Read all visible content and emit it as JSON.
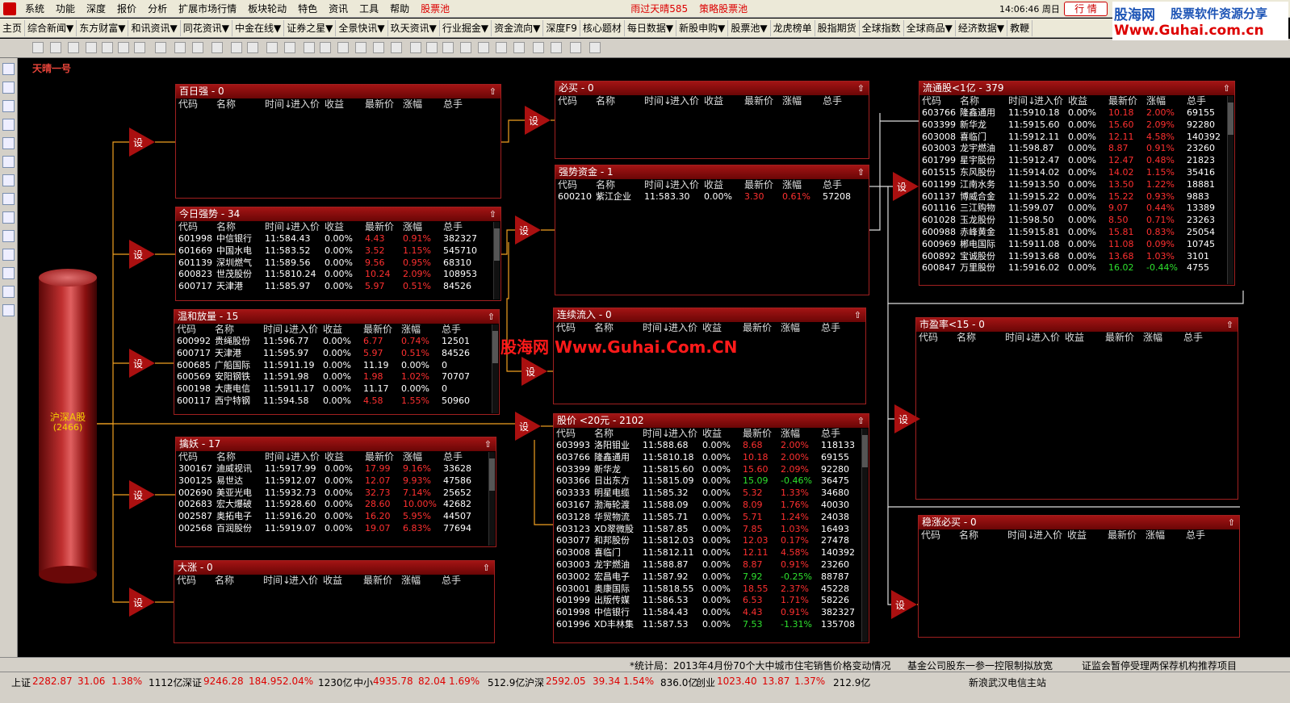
{
  "menu": {
    "items": [
      "系统",
      "功能",
      "深度",
      "报价",
      "分析",
      "扩展市场行情",
      "板块轮动",
      "特色",
      "资讯",
      "工具",
      "帮助"
    ],
    "pool": "股票池",
    "center_links": [
      "雨过天晴585",
      "策略股票池"
    ],
    "clock": "14:06:46 周日",
    "quote_button": "行 情"
  },
  "brand": {
    "cn": "股海网",
    "tagline": "股票软件资源分享",
    "url": "Www.Guhai.com.cn"
  },
  "toolbar": [
    "主页",
    "综合新闻▼",
    "东方财富▼",
    "和讯资讯▼",
    "同花资讯▼",
    "中金在线▼",
    "证券之星▼",
    "全景快讯▼",
    "玖天资讯▼",
    "行业掘金▼",
    "资金流向▼",
    "深度F9",
    "核心题材",
    "每日数据▼",
    "新股申购▼",
    "股票池▼",
    "龙虎榜单",
    "股指期货",
    "全球指数",
    "全球商品▼",
    "经济数据▼",
    "教鞭"
  ],
  "window_title": "天晴一号",
  "source": {
    "name": "沪深A股",
    "count": "(2466)"
  },
  "set_label": "设",
  "watermark": "股海网 Www.Guhai.Com.CN",
  "columns": [
    "代码",
    "名称",
    "时间↓",
    "进入价",
    "收益",
    "最新价",
    "涨幅",
    "总手"
  ],
  "panels": [
    {
      "id": "p1",
      "title": "百日强 - 0",
      "rows": []
    },
    {
      "id": "p2",
      "title": "今日强势 - 34",
      "rows": [
        [
          "601998",
          "中信银行",
          "11:58",
          "4.43",
          "0.00%",
          "4.43",
          "0.91%",
          "382327",
          "r"
        ],
        [
          "601669",
          "中国水电",
          "11:58",
          "3.52",
          "0.00%",
          "3.52",
          "1.15%",
          "545710",
          "r"
        ],
        [
          "601139",
          "深圳燃气",
          "11:58",
          "9.56",
          "0.00%",
          "9.56",
          "0.95%",
          "68310",
          "r"
        ],
        [
          "600823",
          "世茂股份",
          "11:58",
          "10.24",
          "0.00%",
          "10.24",
          "2.09%",
          "108953",
          "r"
        ],
        [
          "600717",
          "天津港",
          "11:58",
          "5.97",
          "0.00%",
          "5.97",
          "0.51%",
          "84526",
          "r"
        ]
      ]
    },
    {
      "id": "p3",
      "title": "温和放量 - 15",
      "rows": [
        [
          "600992",
          "贵绳股份",
          "11:59",
          "6.77",
          "0.00%",
          "6.77",
          "0.74%",
          "12501",
          "r"
        ],
        [
          "600717",
          "天津港",
          "11:59",
          "5.97",
          "0.00%",
          "5.97",
          "0.51%",
          "84526",
          "r"
        ],
        [
          "600685",
          "广船国际",
          "11:59",
          "11.19",
          "0.00%",
          "11.19",
          "0.00%",
          "0",
          "w"
        ],
        [
          "600569",
          "安阳钢铁",
          "11:59",
          "1.98",
          "0.00%",
          "1.98",
          "1.02%",
          "70707",
          "r"
        ],
        [
          "600198",
          "大唐电信",
          "11:59",
          "11.17",
          "0.00%",
          "11.17",
          "0.00%",
          "0",
          "w"
        ],
        [
          "600117",
          "西宁特钢",
          "11:59",
          "4.58",
          "0.00%",
          "4.58",
          "1.55%",
          "50960",
          "r"
        ]
      ]
    },
    {
      "id": "p4",
      "title": "擒妖 - 17",
      "rows": [
        [
          "300167",
          "迪威视讯",
          "11:59",
          "17.99",
          "0.00%",
          "17.99",
          "9.16%",
          "33628",
          "r"
        ],
        [
          "300125",
          "易世达",
          "11:59",
          "12.07",
          "0.00%",
          "12.07",
          "9.93%",
          "47586",
          "r"
        ],
        [
          "002690",
          "美亚光电",
          "11:59",
          "32.73",
          "0.00%",
          "32.73",
          "7.14%",
          "25652",
          "r"
        ],
        [
          "002683",
          "宏大爆破",
          "11:59",
          "28.60",
          "0.00%",
          "28.60",
          "10.00%",
          "42682",
          "r"
        ],
        [
          "002587",
          "奥拓电子",
          "11:59",
          "16.20",
          "0.00%",
          "16.20",
          "5.95%",
          "44507",
          "r"
        ],
        [
          "002568",
          "百润股份",
          "11:59",
          "19.07",
          "0.00%",
          "19.07",
          "6.83%",
          "77694",
          "r"
        ]
      ]
    },
    {
      "id": "p5",
      "title": "大涨 - 0",
      "rows": []
    },
    {
      "id": "p6",
      "title": "必买 - 0",
      "rows": []
    },
    {
      "id": "p7",
      "title": "强势资金 - 1",
      "rows": [
        [
          "600210",
          "紫江企业",
          "11:58",
          "3.30",
          "0.00%",
          "3.30",
          "0.61%",
          "57208",
          "r"
        ]
      ]
    },
    {
      "id": "p8",
      "title": "连续流入 - 0",
      "rows": []
    },
    {
      "id": "p9",
      "title": "股价 <20元 - 2102",
      "rows": [
        [
          "603993",
          "洛阳钼业",
          "11:58",
          "8.68",
          "0.00%",
          "8.68",
          "2.00%",
          "118133",
          "r"
        ],
        [
          "603766",
          "隆鑫通用",
          "11:58",
          "10.18",
          "0.00%",
          "10.18",
          "2.00%",
          "69155",
          "r"
        ],
        [
          "603399",
          "新华龙",
          "11:58",
          "15.60",
          "0.00%",
          "15.60",
          "2.09%",
          "92280",
          "r"
        ],
        [
          "603366",
          "日出东方",
          "11:58",
          "15.09",
          "0.00%",
          "15.09",
          "-0.46%",
          "36475",
          "g"
        ],
        [
          "603333",
          "明星电缆",
          "11:58",
          "5.32",
          "0.00%",
          "5.32",
          "1.33%",
          "34680",
          "r"
        ],
        [
          "603167",
          "渤海轮渡",
          "11:58",
          "8.09",
          "0.00%",
          "8.09",
          "1.76%",
          "40030",
          "r"
        ],
        [
          "603128",
          "华贸物流",
          "11:58",
          "5.71",
          "0.00%",
          "5.71",
          "1.24%",
          "24038",
          "r"
        ],
        [
          "603123",
          "XD翠微股",
          "11:58",
          "7.85",
          "0.00%",
          "7.85",
          "1.03%",
          "16493",
          "r"
        ],
        [
          "603077",
          "和邦股份",
          "11:58",
          "12.03",
          "0.00%",
          "12.03",
          "0.17%",
          "27478",
          "r"
        ],
        [
          "603008",
          "喜临门",
          "11:58",
          "12.11",
          "0.00%",
          "12.11",
          "4.58%",
          "140392",
          "r"
        ],
        [
          "603003",
          "龙宇燃油",
          "11:58",
          "8.87",
          "0.00%",
          "8.87",
          "0.91%",
          "23260",
          "r"
        ],
        [
          "603002",
          "宏昌电子",
          "11:58",
          "7.92",
          "0.00%",
          "7.92",
          "-0.25%",
          "88787",
          "g"
        ],
        [
          "603001",
          "奥康国际",
          "11:58",
          "18.55",
          "0.00%",
          "18.55",
          "2.37%",
          "45228",
          "r"
        ],
        [
          "601999",
          "出版传媒",
          "11:58",
          "6.53",
          "0.00%",
          "6.53",
          "1.71%",
          "58226",
          "r"
        ],
        [
          "601998",
          "中信银行",
          "11:58",
          "4.43",
          "0.00%",
          "4.43",
          "0.91%",
          "382327",
          "r"
        ],
        [
          "601996",
          "XD丰林集",
          "11:58",
          "7.53",
          "0.00%",
          "7.53",
          "-1.31%",
          "135708",
          "g"
        ]
      ]
    },
    {
      "id": "p10",
      "title": "流通股<1亿 - 379",
      "rows": [
        [
          "603766",
          "隆鑫通用",
          "11:59",
          "10.18",
          "0.00%",
          "10.18",
          "2.00%",
          "69155",
          "r"
        ],
        [
          "603399",
          "新华龙",
          "11:59",
          "15.60",
          "0.00%",
          "15.60",
          "2.09%",
          "92280",
          "r"
        ],
        [
          "603008",
          "喜临门",
          "11:59",
          "12.11",
          "0.00%",
          "12.11",
          "4.58%",
          "140392",
          "r"
        ],
        [
          "603003",
          "龙宇燃油",
          "11:59",
          "8.87",
          "0.00%",
          "8.87",
          "0.91%",
          "23260",
          "r"
        ],
        [
          "601799",
          "星宇股份",
          "11:59",
          "12.47",
          "0.00%",
          "12.47",
          "0.48%",
          "21823",
          "r"
        ],
        [
          "601515",
          "东风股份",
          "11:59",
          "14.02",
          "0.00%",
          "14.02",
          "1.15%",
          "35416",
          "r"
        ],
        [
          "601199",
          "江南水务",
          "11:59",
          "13.50",
          "0.00%",
          "13.50",
          "1.22%",
          "18881",
          "r"
        ],
        [
          "601137",
          "博威合金",
          "11:59",
          "15.22",
          "0.00%",
          "15.22",
          "0.93%",
          "9883",
          "r"
        ],
        [
          "601116",
          "三江购物",
          "11:59",
          "9.07",
          "0.00%",
          "9.07",
          "0.44%",
          "13389",
          "r"
        ],
        [
          "601028",
          "玉龙股份",
          "11:59",
          "8.50",
          "0.00%",
          "8.50",
          "0.71%",
          "23263",
          "r"
        ],
        [
          "600988",
          "赤峰黄金",
          "11:59",
          "15.81",
          "0.00%",
          "15.81",
          "0.83%",
          "25054",
          "r"
        ],
        [
          "600969",
          "郴电国际",
          "11:59",
          "11.08",
          "0.00%",
          "11.08",
          "0.09%",
          "10745",
          "r"
        ],
        [
          "600892",
          "宝诚股份",
          "11:59",
          "13.68",
          "0.00%",
          "13.68",
          "1.03%",
          "3101",
          "r"
        ],
        [
          "600847",
          "万里股份",
          "11:59",
          "16.02",
          "0.00%",
          "16.02",
          "-0.44%",
          "4755",
          "g"
        ]
      ]
    },
    {
      "id": "p11",
      "title": "市盈率<15 - 0",
      "rows": []
    },
    {
      "id": "p12",
      "title": "稳涨必买 - 0",
      "rows": []
    }
  ],
  "ticker": [
    "*统计局：2013年4月份70个大中城市住宅销售价格变动情况",
    "基金公司股东一参一控限制拟放宽",
    "证监会暂停受理两保荐机构推荐项目"
  ],
  "status": {
    "sh": {
      "label": "上证",
      "value": "2282.87",
      "chg": "31.06",
      "pct": "1.38%",
      "amt": "1112亿"
    },
    "sz": {
      "label": "深证",
      "value": "9246.28",
      "chg": "184.95",
      "pct": "2.04%",
      "amt": "1230亿"
    },
    "zx": {
      "label": "中小",
      "value": "4935.78",
      "chg": "82.04",
      "pct": "1.69%",
      "amt": "512.9亿"
    },
    "hs": {
      "label": "沪深",
      "value": "2592.05",
      "chg": "39.34",
      "pct": "1.54%",
      "amt": "836.0亿"
    },
    "cy": {
      "label": "创业",
      "value": "1023.40",
      "chg": "13.87",
      "pct": "1.37%",
      "amt": "212.9亿"
    },
    "news": "新浪武汉电信主站"
  },
  "colors": {
    "accent": "#a31414",
    "up": "#ff3030",
    "down": "#2ee02e",
    "wire": "#f0a020"
  }
}
